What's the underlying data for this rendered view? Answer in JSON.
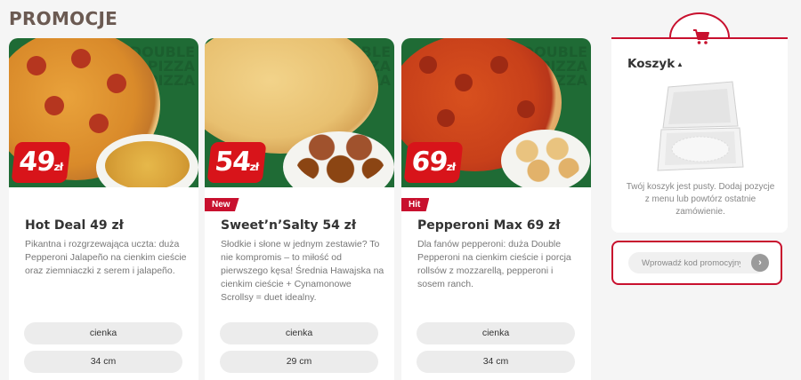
{
  "page": {
    "title": "PROMOCJE"
  },
  "products": [
    {
      "name": "Hot Deal 49 zł",
      "price_number": "49",
      "price_unit": "zł",
      "tag": "",
      "description": "Pikantna i rozgrzewająca uczta: duża Pepperoni Jalapeño na cienkim cieście oraz ziemniaczki z serem i jalapeño.",
      "options": [
        "cienka",
        "34 cm"
      ]
    },
    {
      "name": "Sweet’n’Salty 54 zł",
      "price_number": "54",
      "price_unit": "zł",
      "tag": "New",
      "description": "Słodkie i słone w jednym zestawie? To nie kompromis – to miłość od pierwszego kęsa! Średnia Hawajska na cienkim cieście + Cynamonowe Scrollsy = duet idealny.",
      "options": [
        "cienka",
        "29 cm"
      ]
    },
    {
      "name": "Pepperoni Max 69 zł",
      "price_number": "69",
      "price_unit": "zł",
      "tag": "Hit",
      "description": "Dla fanów pepperoni: duża Double Pepperoni na cienkim cieście i porcja rollsów z mozzarellą, pepperoni i sosem ranch.",
      "options": [
        "cienka",
        "34 cm"
      ]
    }
  ],
  "cart": {
    "title": "Koszyk",
    "empty_text": "Twój koszyk jest pusty. Dodaj pozycje z menu lub powtórz ostatnie zamówienie.",
    "icon": "cart-icon"
  },
  "promo": {
    "placeholder": "Wprowadź kod promocyjny",
    "submit_icon": "chevron-right-icon"
  },
  "colors": {
    "accent": "#c8102e",
    "badge": "#d8141a",
    "image_bg": "#1f6b35"
  }
}
